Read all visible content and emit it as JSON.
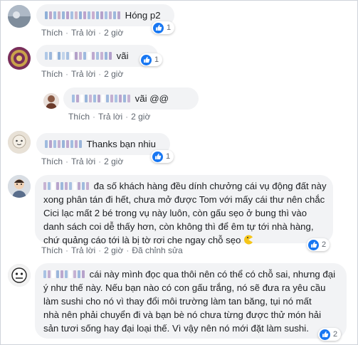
{
  "actions": {
    "like": "Thích",
    "reply": "Trả lời",
    "edited": "Đã chỉnh sửa"
  },
  "colors": {
    "bubble": "#f2f3f5",
    "like_badge": "#1877f2",
    "meta_text": "#606770"
  },
  "comments": [
    {
      "id": "c1",
      "text": "Hóng p2",
      "time": "2 giờ",
      "likes": "1"
    },
    {
      "id": "c2",
      "text": "vãi",
      "time": "2 giờ",
      "likes": "1"
    },
    {
      "id": "c3",
      "text": "vãi @@",
      "time": "2 giờ"
    },
    {
      "id": "c4",
      "text": "Thanks bạn nhiu",
      "time": "2 giờ",
      "likes": "1"
    },
    {
      "id": "c5",
      "lines": [
        "đa số khách hàng đều dính chưởng cái vụ động đất này",
        "xong phân tán đi hết, chưa mở được Tom với mấy cái thư nên chắc",
        "Cici lạc mất 2 bé trong vụ này luôn, còn gấu sẹo ở bung thì vào",
        "danh sách coi dễ thấy hơn, còn không thì để êm tự tới nhà hàng,",
        "chứ quảng cáo tới là bị tờ rơi che ngay chỗ sẹo"
      ],
      "time": "2 giờ",
      "likes": "2"
    },
    {
      "id": "c6",
      "lines": [
        "cái này mình đọc qua thôi nên có thể có chỗ sai, nhưng đại",
        "ý như thế này. Nếu bạn nào có con gấu trắng, nó sẽ đưa ra yêu cầu",
        "làm sushi cho nó vì thay đổi môi trường làm tan băng, tụi nó mất",
        "nhà nên phải chuyển đi và bạn bè nó chưa từng được thử món hải",
        "sản tươi sống hay đại loại thế. Vì vậy nên nó mới đặt làm sushi."
      ],
      "likes": "2"
    }
  ]
}
